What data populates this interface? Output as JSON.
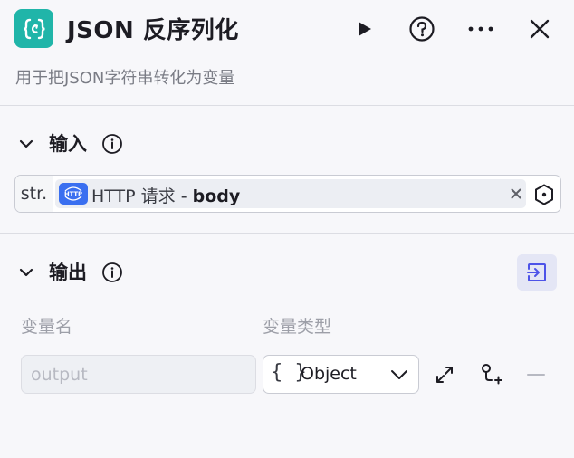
{
  "header": {
    "title": "JSON 反序列化",
    "subtitle": "用于把JSON字符串转化为变量",
    "node_icon": "json-braces-icon",
    "actions": [
      "play-icon",
      "help-icon",
      "more-icon",
      "close-icon"
    ]
  },
  "input_section": {
    "title": "输入",
    "param": {
      "type_tag": "str.",
      "ref_source": "HTTP 请求 - ",
      "ref_field": "body",
      "source_icon_text": "HTTP"
    }
  },
  "output_section": {
    "title": "输出",
    "col_name": "变量名",
    "col_type": "变量类型",
    "row": {
      "name_placeholder": "output",
      "type_glyph": "{ }",
      "type_value": "Object"
    }
  },
  "colors": {
    "accent": "#20b5a9",
    "http_badge": "#3a6ff0",
    "action_bg": "#e4e6f5",
    "action_fg": "#4d53e8"
  }
}
